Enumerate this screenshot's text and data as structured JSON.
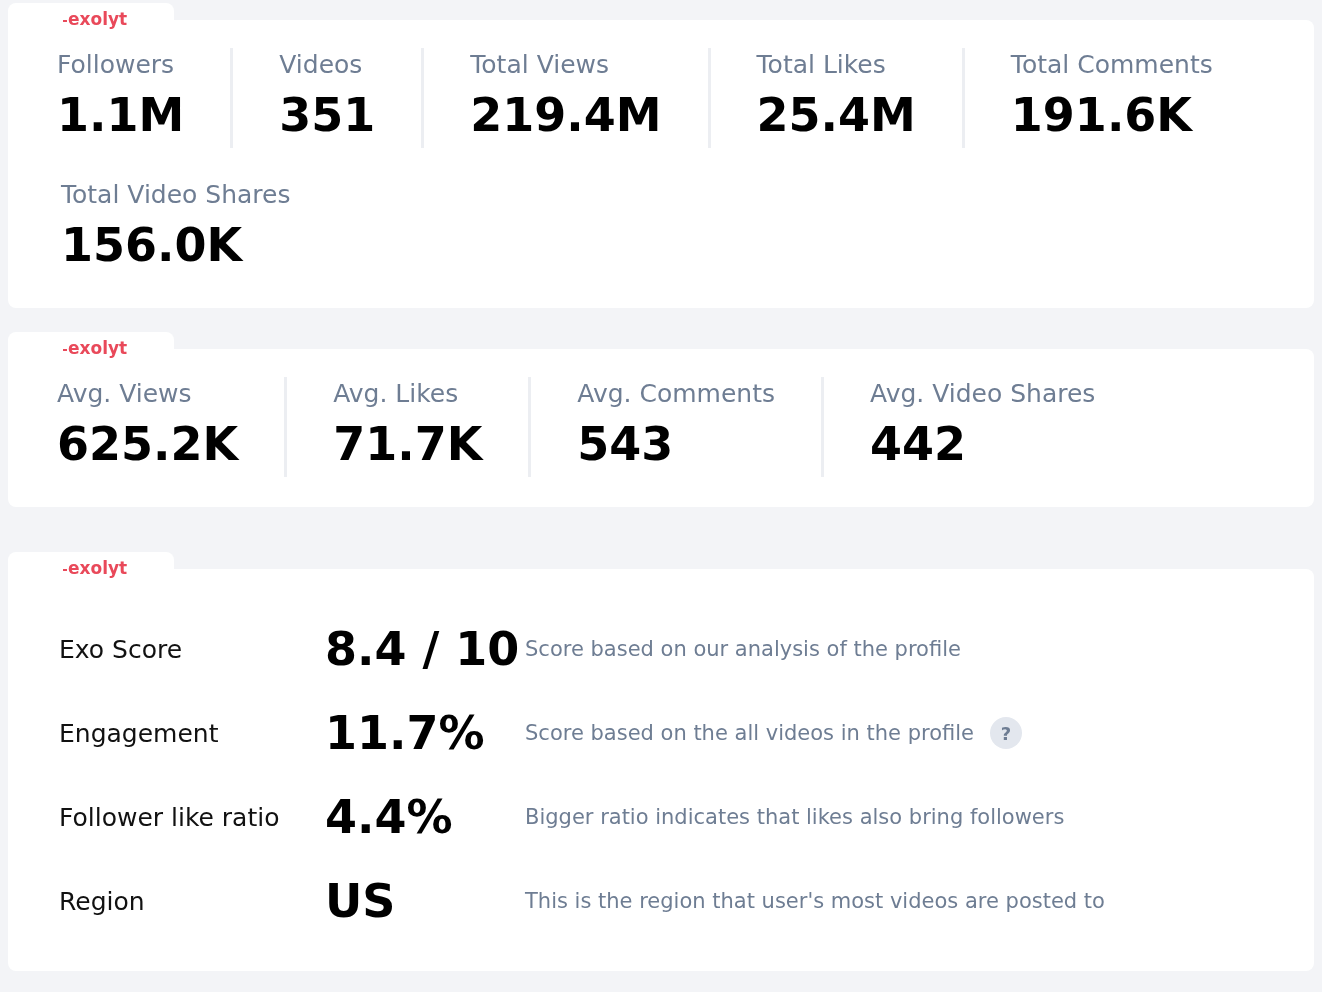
{
  "summary_card": {
    "logo": "exolyt",
    "rows": [
      [
        {
          "label": "Followers",
          "value": "1.1M"
        },
        {
          "label": "Videos",
          "value": "351"
        },
        {
          "label": "Total Views",
          "value": "219.4M"
        },
        {
          "label": "Total Likes",
          "value": "25.4M"
        },
        {
          "label": "Total Comments",
          "value": "191.6K"
        }
      ],
      [
        {
          "label": "Total Video Shares",
          "value": "156.0K"
        }
      ]
    ]
  },
  "average_card": {
    "logo": "exolyt",
    "rows": [
      [
        {
          "label": "Avg. Views",
          "value": "625.2K"
        },
        {
          "label": "Avg. Likes",
          "value": "71.7K"
        },
        {
          "label": "Avg. Comments",
          "value": "543"
        },
        {
          "label": "Avg. Video Shares",
          "value": "442"
        }
      ]
    ]
  },
  "score_card": {
    "logo": "exolyt",
    "metrics": [
      {
        "label": "Exo Score",
        "value": "8.4 / 10",
        "description": "Score based on our analysis of the profile"
      },
      {
        "label": "Engagement",
        "value": "11.7%",
        "description": "Score based on the all videos in the profile",
        "help": "?"
      },
      {
        "label": "Follower like ratio",
        "value": "4.4%",
        "description": "Bigger ratio indicates that likes also bring followers"
      },
      {
        "label": "Region",
        "value": "US",
        "description": "This is the region that user's most videos are posted to"
      }
    ]
  }
}
